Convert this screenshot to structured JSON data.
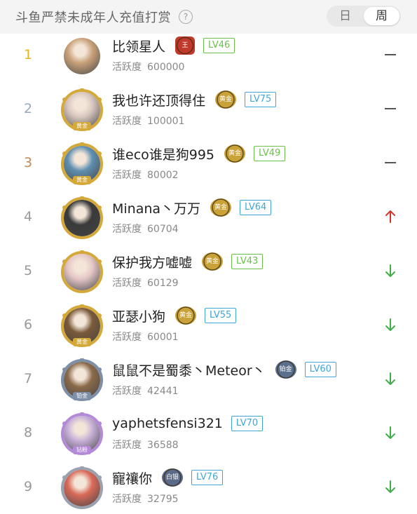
{
  "header": {
    "title": "斗鱼严禁未成年人充值打赏",
    "help_glyph": "?",
    "toggle": {
      "day_label": "日",
      "week_label": "周",
      "selected": "周"
    }
  },
  "colors": {
    "rank_1": "#e6b422",
    "rank_2": "#9aa8c0",
    "rank_3": "#c08a5a",
    "rank_other": "#999999",
    "trend_up": "#d0352c",
    "trend_down": "#3fae49",
    "trend_flat": "#555555",
    "lv_green": "#6cc04a",
    "lv_blue": "#3ea6d8"
  },
  "ranking": [
    {
      "rank": "1",
      "name": "比领星人",
      "badge": {
        "label": "王",
        "icon": "king-badge-icon"
      },
      "level": "LV46",
      "level_color": "green",
      "activity_label": "活跃度",
      "activity": "600000",
      "trend": "flat",
      "avatar_icon": "avatar-cartoon-icon",
      "frame": "none"
    },
    {
      "rank": "2",
      "name": "我也许还顶得住",
      "badge": {
        "label": "黄金",
        "icon": "gold-badge-icon"
      },
      "level": "LV75",
      "level_color": "blue",
      "activity_label": "活跃度",
      "activity": "100001",
      "trend": "flat",
      "avatar_icon": "avatar-user-icon",
      "frame": "gold",
      "frame_label": "黄金"
    },
    {
      "rank": "3",
      "name": "谁eco谁是狗995",
      "badge": {
        "label": "黄金",
        "icon": "gold-badge-icon"
      },
      "level": "LV49",
      "level_color": "green",
      "activity_label": "活跃度",
      "activity": "80002",
      "trend": "flat",
      "avatar_icon": "avatar-user-icon",
      "frame": "gold",
      "frame_label": "黄金"
    },
    {
      "rank": "4",
      "name": "Minana丶万万",
      "badge": {
        "label": "黄金",
        "icon": "gold-badge-icon"
      },
      "level": "LV64",
      "level_color": "blue",
      "activity_label": "活跃度",
      "activity": "60704",
      "trend": "up",
      "avatar_icon": "avatar-user-icon",
      "frame": "gold"
    },
    {
      "rank": "5",
      "name": "保护我方嘘嘘",
      "badge": {
        "label": "黄金",
        "icon": "gold-badge-icon"
      },
      "level": "LV43",
      "level_color": "green",
      "activity_label": "活跃度",
      "activity": "60129",
      "trend": "down",
      "avatar_icon": "avatar-user-icon",
      "frame": "gold"
    },
    {
      "rank": "6",
      "name": "亚瑟小狗",
      "badge": {
        "label": "黄金",
        "icon": "gold-badge-icon"
      },
      "level": "LV55",
      "level_color": "blue",
      "activity_label": "活跃度",
      "activity": "60001",
      "trend": "down",
      "avatar_icon": "avatar-user-icon",
      "frame": "gold",
      "frame_label": "黄金"
    },
    {
      "rank": "7",
      "name": "鼠鼠不是蜀黍丶Meteor丶",
      "badge": {
        "label": "铂金",
        "icon": "platinum-badge-icon"
      },
      "level": "LV60",
      "level_color": "blue",
      "activity_label": "活跃度",
      "activity": "42441",
      "trend": "down",
      "avatar_icon": "avatar-user-icon",
      "frame": "platinum",
      "frame_label": "铂金"
    },
    {
      "rank": "8",
      "name": "yaphetsfensi321",
      "badge": null,
      "level": "LV70",
      "level_color": "blue",
      "activity_label": "活跃度",
      "activity": "36588",
      "trend": "down",
      "avatar_icon": "avatar-user-icon",
      "frame": "diamond",
      "frame_label": "钻粉"
    },
    {
      "rank": "9",
      "name": "寵禳你",
      "badge": {
        "label": "白银",
        "icon": "silver-badge-icon"
      },
      "level": "LV76",
      "level_color": "blue",
      "activity_label": "活跃度",
      "activity": "32795",
      "trend": "down",
      "avatar_icon": "avatar-user-icon",
      "frame": "silver"
    }
  ]
}
